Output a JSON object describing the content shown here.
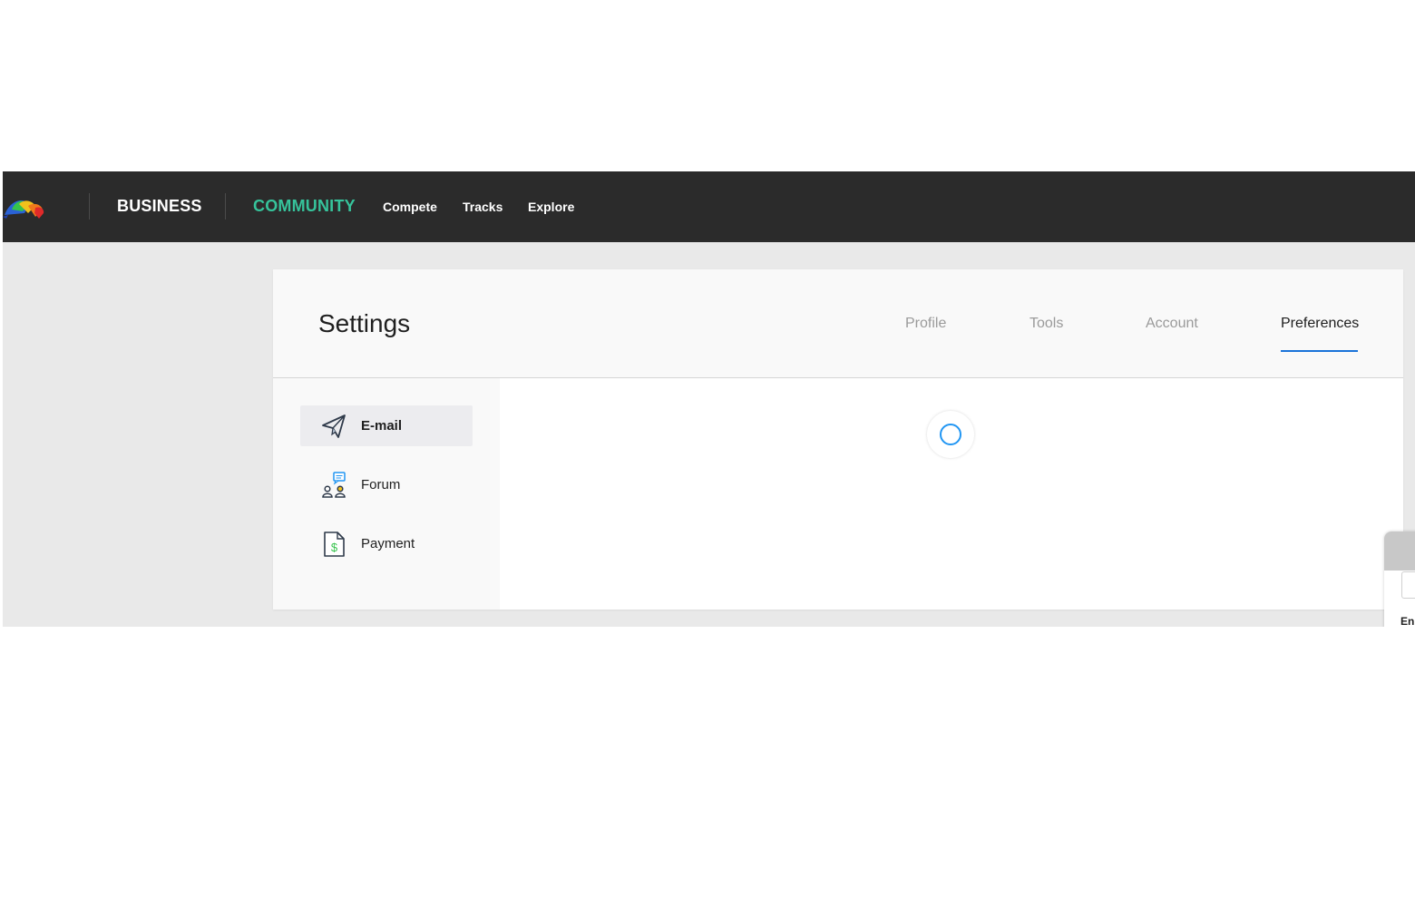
{
  "header": {
    "business_label": "BUSINESS",
    "community_label": "COMMUNITY",
    "links": [
      "Compete",
      "Tracks",
      "Explore"
    ]
  },
  "settings": {
    "title": "Settings",
    "tabs": [
      {
        "label": "Profile",
        "active": false
      },
      {
        "label": "Tools",
        "active": false
      },
      {
        "label": "Account",
        "active": false
      },
      {
        "label": "Preferences",
        "active": true
      }
    ]
  },
  "sidebar": {
    "items": [
      {
        "label": "E-mail",
        "icon": "paper-plane-icon",
        "active": true
      },
      {
        "label": "Forum",
        "icon": "forum-people-icon",
        "active": false
      },
      {
        "label": "Payment",
        "icon": "invoice-dollar-icon",
        "active": false
      }
    ]
  },
  "content": {
    "state": "loading"
  },
  "widget": {
    "partial_text": "En"
  },
  "colors": {
    "topbar": "#2b2b2b",
    "community_accent": "#36c39b",
    "tab_underline": "#1a73d9",
    "spinner": "#2196f3"
  }
}
